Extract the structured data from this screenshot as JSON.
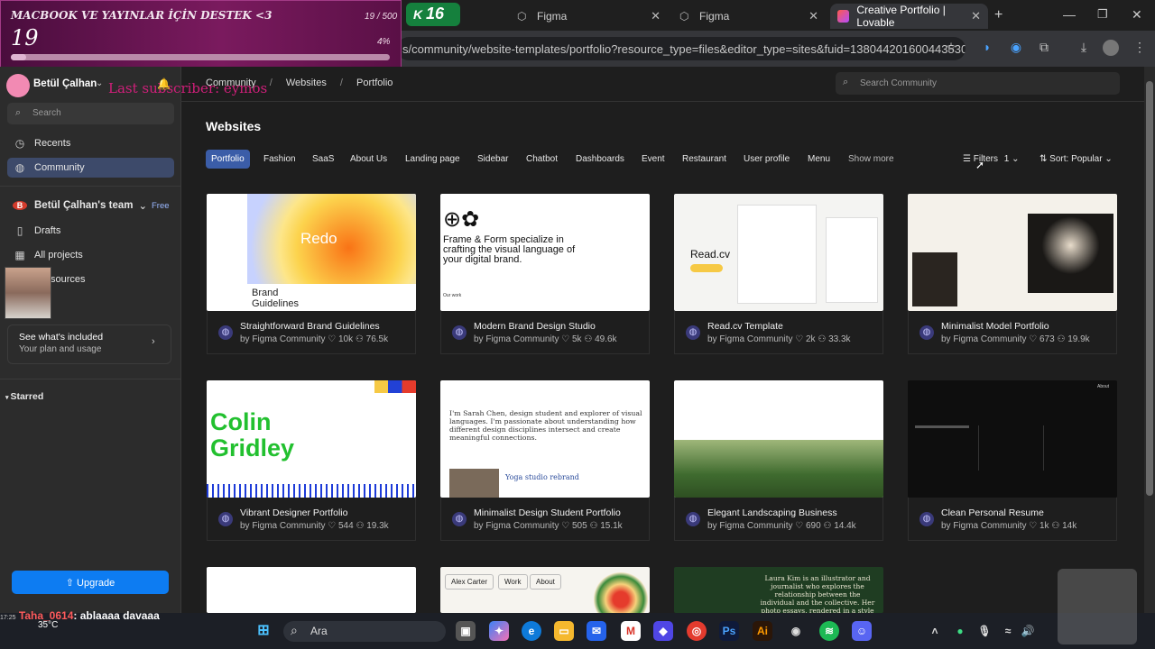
{
  "overlay": {
    "title": "MACBOOK VE YAYINLAR İÇİN DESTEK <3",
    "number": "19",
    "count": "19 / 500",
    "percent": "4%",
    "progress": 0.04,
    "subscriber": "Last subscriber: eymos",
    "tab_counter": "16"
  },
  "browser": {
    "tabs": [
      {
        "label": "Figma"
      },
      {
        "label": "Figma"
      },
      {
        "label": "Creative Portfolio | Lovable"
      }
    ],
    "url": "s/community/website-templates/portfolio?resource_type=files&editor_type=sites&fuid=1380442016004435302"
  },
  "sidebar": {
    "user": "Betül Çalhan",
    "search": "Search",
    "recents": "Recents",
    "community": "Community",
    "team": "Betül Çalhan's team",
    "team_badge": "Free",
    "drafts": "Drafts",
    "projects": "All projects",
    "resources": "sources",
    "plan_title": "See what's included",
    "plan_sub": "Your plan and usage",
    "starred": "Starred",
    "upgrade": "Upgrade"
  },
  "header": {
    "breadcrumb": [
      "Community",
      "Websites",
      "Portfolio"
    ],
    "search": "Search Community",
    "title": "Websites"
  },
  "chips": [
    "Portfolio",
    "Fashion",
    "SaaS",
    "About Us",
    "Landing page",
    "Sidebar",
    "Chatbot",
    "Dashboards",
    "Event",
    "Restaurant",
    "User profile",
    "Menu",
    "Show more"
  ],
  "filters": {
    "label": "Filters",
    "count": "1",
    "sort": "Sort: Popular"
  },
  "cards": [
    {
      "title": "Straightforward Brand Guidelines",
      "by": "by Figma Community",
      "likes": "10k",
      "users": "76.5k",
      "preview": "Redo",
      "sub": "Brand Guidelines"
    },
    {
      "title": "Modern Brand Design Studio",
      "by": "by Figma Community",
      "likes": "5k",
      "users": "49.6k",
      "preview": "Frame & Form specialize in crafting the visual language of your digital brand.",
      "sub": "Our work"
    },
    {
      "title": "Read.cv Template",
      "by": "by Figma Community",
      "likes": "2k",
      "users": "33.3k",
      "preview": "Read.cv",
      "sub": ""
    },
    {
      "title": "Minimalist Model Portfolio",
      "by": "by Figma Community",
      "likes": "673",
      "users": "19.9k",
      "preview": "",
      "sub": ""
    },
    {
      "title": "Vibrant Designer Portfolio",
      "by": "by Figma Community",
      "likes": "544",
      "users": "19.3k",
      "preview": "Colin Gridley",
      "sub": ""
    },
    {
      "title": "Minimalist Design Student Portfolio",
      "by": "by Figma Community",
      "likes": "505",
      "users": "15.1k",
      "preview": "I'm Sarah Chen, design student and explorer of visual languages. I'm passionate about understanding how different design disciplines intersect and create meaningful connections.",
      "sub": "Yoga studio rebrand"
    },
    {
      "title": "Elegant Landscaping Business",
      "by": "by Figma Community",
      "likes": "690",
      "users": "14.4k",
      "preview": "",
      "sub": ""
    },
    {
      "title": "Clean Personal Resume",
      "by": "by Figma Community",
      "likes": "1k",
      "users": "14k",
      "preview": "",
      "sub": "About"
    },
    {
      "title": "",
      "by": "",
      "likes": "",
      "users": "",
      "preview": "",
      "sub": ""
    },
    {
      "title": "",
      "by": "",
      "likes": "",
      "users": "",
      "preview": "Alex Carter",
      "sub": ""
    },
    {
      "title": "",
      "by": "",
      "likes": "",
      "users": "",
      "preview": "Laura Kim is an illustrator and journalist who explores the relationship between the individual and the collective. Her photo essays, rendered in a style",
      "sub": ""
    }
  ],
  "preview_tabs": {
    "work": "Work",
    "about": "About"
  },
  "taskbar": {
    "search": "Ara",
    "temp": "35°C",
    "chat_user": "Taha_0614",
    "chat_msg": ": ablaaaa davaaa",
    "time": "17:25"
  },
  "colors": {
    "accent": "#0d7cf2",
    "chip_active": "#3b5da8",
    "overlay": "#7a1a5e"
  }
}
